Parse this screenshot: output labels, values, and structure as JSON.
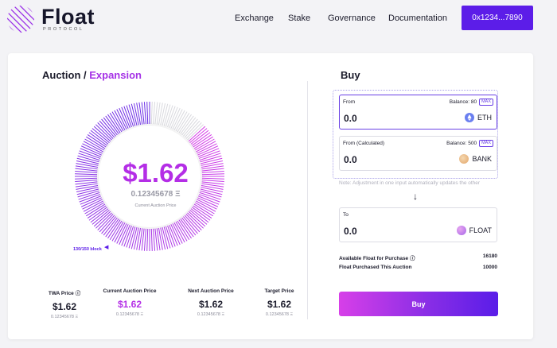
{
  "brand": {
    "name": "Float",
    "sub": "PROTOCOL"
  },
  "nav": [
    {
      "label": "Exchange"
    },
    {
      "label": "Stake"
    },
    {
      "label": "Governance"
    },
    {
      "label": "Documentation"
    }
  ],
  "wallet": {
    "label": "0x1234...7890"
  },
  "auction": {
    "title_a": "Auction",
    "title_sep": " / ",
    "title_b": "Expansion",
    "price": "$1.62",
    "price_eth": "0.12345678 Ξ",
    "price_caption": "Current Auction Price",
    "block_label": "130/150 block",
    "block_progress": 0.8667,
    "stats": [
      {
        "label": "TWA Price ⓘ",
        "value": "$1.62",
        "sub": "0.12345678 Ξ",
        "color": "#1b1b2b"
      },
      {
        "label": "Current Auction Price",
        "value": "$1.62",
        "sub": "0.12345678 Ξ",
        "color": "#b42ee6"
      },
      {
        "label": "Next Auction Price",
        "value": "$1.62",
        "sub": "0.12345678 Ξ",
        "color": "#1b1b2b"
      },
      {
        "label": "Target Price",
        "value": "$1.62",
        "sub": "0.12345678 Ξ",
        "color": "#1b1b2b"
      }
    ]
  },
  "buy": {
    "title": "Buy",
    "from": {
      "label": "From",
      "balance": "Balance: 80",
      "max": "MAX",
      "value": "0.0",
      "token": "ETH"
    },
    "calc": {
      "label": "From (Calculated)",
      "balance": "Balance: 500",
      "max": "MAX",
      "value": "0.0",
      "token": "BANK"
    },
    "note": "Note: Adjustment in one input automatically updates the other",
    "to": {
      "label": "To",
      "value": "0.0",
      "token": "FLOAT"
    },
    "available_label": "Available Float for Purchase ⓘ",
    "available_value": "16180",
    "purchased_label": "Float Purchased This Auction",
    "purchased_value": "10000",
    "button": "Buy"
  },
  "colors": {
    "accent": "#5c1de8",
    "magenta": "#b42ee6",
    "ring_start": "#d73fe8",
    "ring_end": "#6a2ee6",
    "ring_empty": "#d9d9de"
  }
}
